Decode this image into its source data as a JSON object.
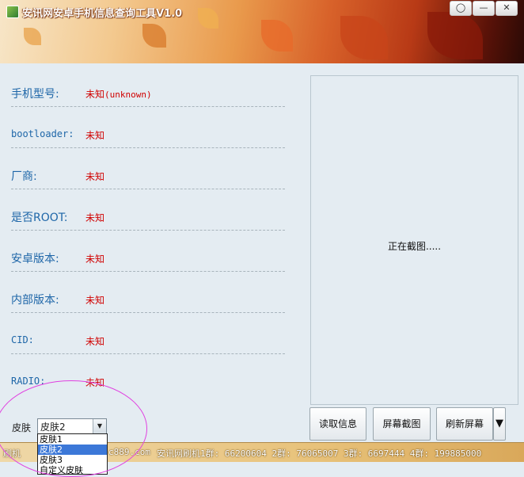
{
  "window": {
    "title": "安讯网安卓手机信息查询工具V1.0",
    "controls": [
      "feedback",
      "minimize",
      "close"
    ]
  },
  "info_rows": [
    {
      "label": "手机型号:",
      "value": "未知",
      "extra": "(unknown)"
    },
    {
      "label": "bootloader:",
      "value": "未知"
    },
    {
      "label": "厂商:",
      "value": "未知"
    },
    {
      "label": "是否ROOT:",
      "value": "未知"
    },
    {
      "label": "安卓版本:",
      "value": "未知"
    },
    {
      "label": "内部版本:",
      "value": "未知"
    },
    {
      "label": "CID:",
      "value": "未知"
    },
    {
      "label": "RADIO:",
      "value": "未知"
    }
  ],
  "screenshot": {
    "status": "正在截图....."
  },
  "buttons": {
    "read_info": "读取信息",
    "screen_capture": "屏幕截图",
    "refresh_screen": "刷新屏幕",
    "more": "▼"
  },
  "skin": {
    "label": "皮肤",
    "selected": "皮肤2",
    "options": [
      "皮肤1",
      "皮肤2",
      "皮肤3",
      "自定义皮肤"
    ]
  },
  "statusbar": {
    "left": "刷机",
    "middle": "c889.com",
    "groups": "安讯网刷机1群: 66200604 2群: 76065007 3群: 6697444 4群: 199885000"
  },
  "colors": {
    "label": "#1e66a8",
    "value": "#d00000",
    "selection": "#3c78d8",
    "highlight": "#e040e0"
  }
}
